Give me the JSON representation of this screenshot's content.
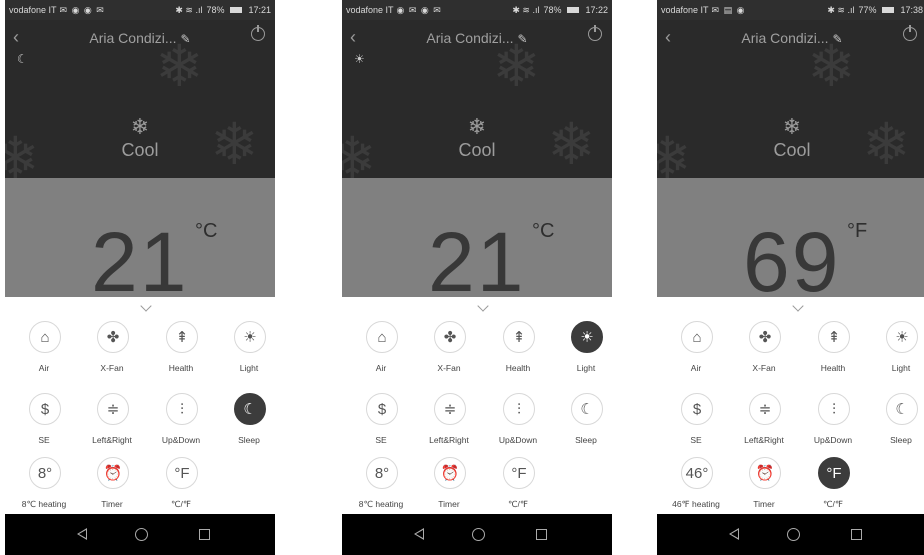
{
  "screens": [
    {
      "status": {
        "carrier": "vodafone IT",
        "icons": "✉ ◉ ◉ ✉",
        "signal": "✱ ≋ .ıl",
        "battery": "78%",
        "time": "17:21"
      },
      "title": "Aria Condizi...",
      "indicator": "moon-icon",
      "mode": "Cool",
      "temperature": "21",
      "unit": "°C",
      "buttons": [
        {
          "label": "Air",
          "icon": "air-icon",
          "glyph": "⌂",
          "on": false
        },
        {
          "label": "X-Fan",
          "icon": "fan-icon",
          "glyph": "✤",
          "on": false
        },
        {
          "label": "Health",
          "icon": "tree-icon",
          "glyph": "⇞",
          "on": false
        },
        {
          "label": "Light",
          "icon": "bulb-icon",
          "glyph": "☀",
          "on": false
        },
        {
          "label": "SE",
          "icon": "dollar-icon",
          "glyph": "$",
          "on": false
        },
        {
          "label": "Left&Right",
          "icon": "swing-horizontal-icon",
          "glyph": "≑",
          "on": false
        },
        {
          "label": "Up&Down",
          "icon": "swing-vertical-icon",
          "glyph": "⫶",
          "on": false
        },
        {
          "label": "Sleep",
          "icon": "moon-icon",
          "glyph": "☾",
          "on": true
        },
        {
          "label": "8℃ heating",
          "icon": "heating-icon",
          "glyph": "8°",
          "on": false
        },
        {
          "label": "Timer",
          "icon": "clock-icon",
          "glyph": "⏰",
          "on": false
        },
        {
          "label": "℃/℉",
          "icon": "fahrenheit-icon",
          "glyph": "°F",
          "on": false
        }
      ]
    },
    {
      "status": {
        "carrier": "vodafone IT",
        "icons": "◉ ✉ ◉ ✉",
        "signal": "✱ ≋ .ıl",
        "battery": "78%",
        "time": "17:22"
      },
      "title": "Aria Condizi...",
      "indicator": "bulb-icon",
      "mode": "Cool",
      "temperature": "21",
      "unit": "°C",
      "buttons": [
        {
          "label": "Air",
          "icon": "air-icon",
          "glyph": "⌂",
          "on": false
        },
        {
          "label": "X-Fan",
          "icon": "fan-icon",
          "glyph": "✤",
          "on": false
        },
        {
          "label": "Health",
          "icon": "tree-icon",
          "glyph": "⇞",
          "on": false
        },
        {
          "label": "Light",
          "icon": "bulb-icon",
          "glyph": "☀",
          "on": true
        },
        {
          "label": "SE",
          "icon": "dollar-icon",
          "glyph": "$",
          "on": false
        },
        {
          "label": "Left&Right",
          "icon": "swing-horizontal-icon",
          "glyph": "≑",
          "on": false
        },
        {
          "label": "Up&Down",
          "icon": "swing-vertical-icon",
          "glyph": "⫶",
          "on": false
        },
        {
          "label": "Sleep",
          "icon": "moon-icon",
          "glyph": "☾",
          "on": false
        },
        {
          "label": "8℃ heating",
          "icon": "heating-icon",
          "glyph": "8°",
          "on": false
        },
        {
          "label": "Timer",
          "icon": "clock-icon",
          "glyph": "⏰",
          "on": false
        },
        {
          "label": "℃/℉",
          "icon": "fahrenheit-icon",
          "glyph": "°F",
          "on": false
        }
      ]
    },
    {
      "status": {
        "carrier": "vodafone IT",
        "icons": "✉ ▤ ◉",
        "signal": "✱ ≋ .ıl",
        "battery": "77%",
        "time": "17:38"
      },
      "title": "Aria Condizi...",
      "indicator": "",
      "mode": "Cool",
      "temperature": "69",
      "unit": "°F",
      "buttons": [
        {
          "label": "Air",
          "icon": "air-icon",
          "glyph": "⌂",
          "on": false
        },
        {
          "label": "X-Fan",
          "icon": "fan-icon",
          "glyph": "✤",
          "on": false
        },
        {
          "label": "Health",
          "icon": "tree-icon",
          "glyph": "⇞",
          "on": false
        },
        {
          "label": "Light",
          "icon": "bulb-icon",
          "glyph": "☀",
          "on": false
        },
        {
          "label": "SE",
          "icon": "dollar-icon",
          "glyph": "$",
          "on": false
        },
        {
          "label": "Left&Right",
          "icon": "swing-horizontal-icon",
          "glyph": "≑",
          "on": false
        },
        {
          "label": "Up&Down",
          "icon": "swing-vertical-icon",
          "glyph": "⫶",
          "on": false
        },
        {
          "label": "Sleep",
          "icon": "moon-icon",
          "glyph": "☾",
          "on": false
        },
        {
          "label": "46℉ heating",
          "icon": "heating-icon",
          "glyph": "46°",
          "on": false
        },
        {
          "label": "Timer",
          "icon": "clock-icon",
          "glyph": "⏰",
          "on": false
        },
        {
          "label": "℃/℉",
          "icon": "fahrenheit-icon",
          "glyph": "°F",
          "on": true
        }
      ]
    }
  ]
}
